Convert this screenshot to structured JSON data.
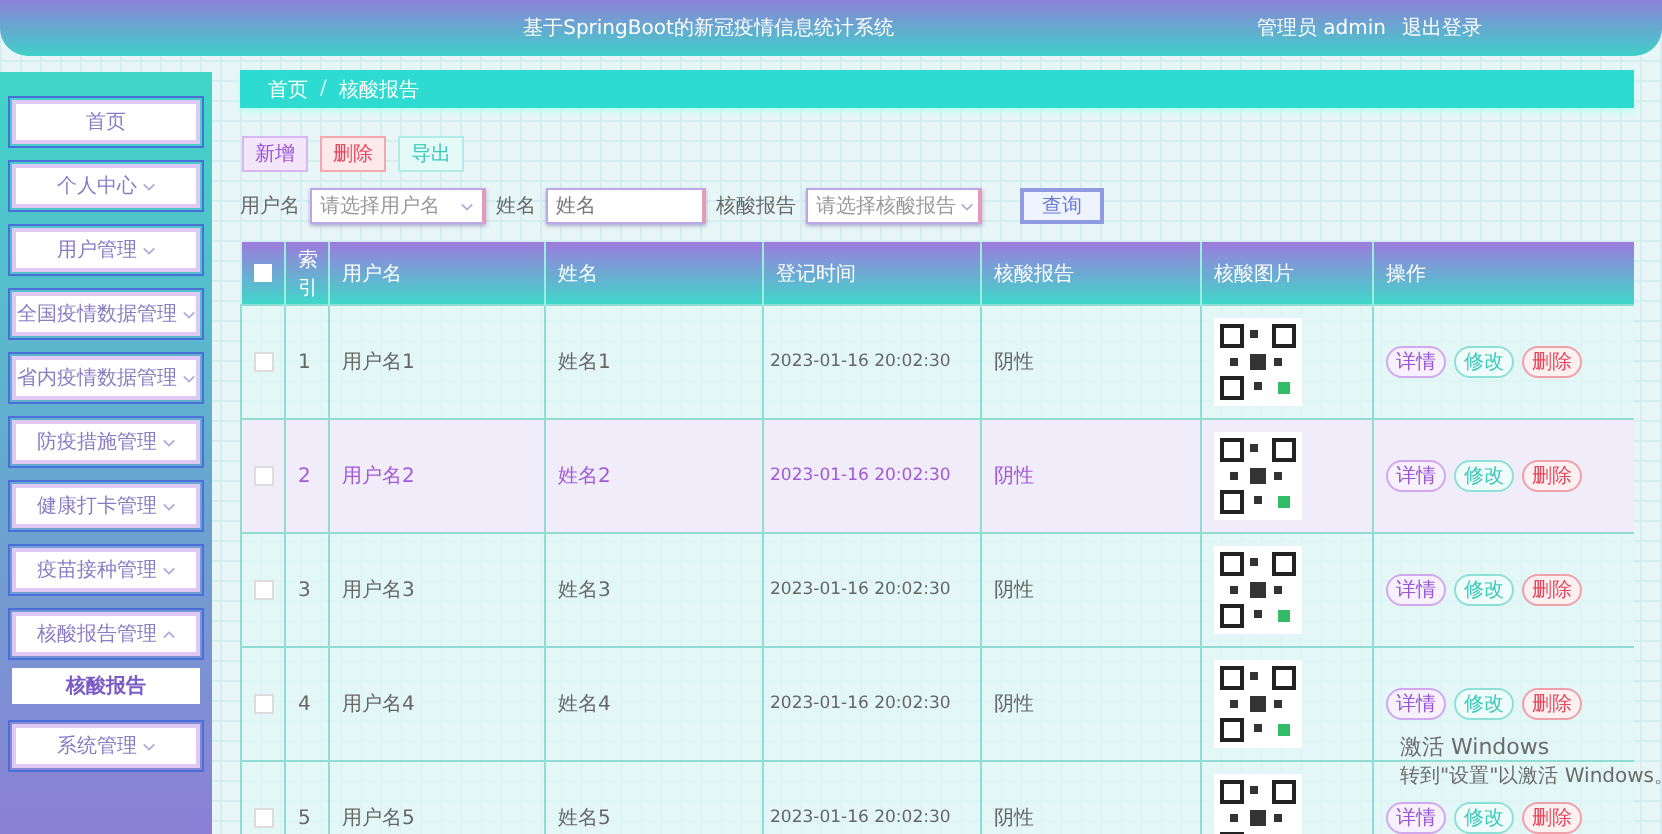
{
  "header": {
    "title": "基于SpringBoot的新冠疫情信息统计系统",
    "user": "管理员 admin",
    "logout": "退出登录"
  },
  "sidebar": {
    "items": [
      {
        "label": "首页",
        "kind": "link",
        "selected": false
      },
      {
        "label": "个人中心",
        "kind": "menu",
        "expanded": false,
        "selected": false
      },
      {
        "label": "用户管理",
        "kind": "menu",
        "expanded": false,
        "selected": false
      },
      {
        "label": "全国疫情数据管理",
        "kind": "menu",
        "expanded": false,
        "selected": false
      },
      {
        "label": "省内疫情数据管理",
        "kind": "menu",
        "expanded": false,
        "selected": false
      },
      {
        "label": "防疫措施管理",
        "kind": "menu",
        "expanded": false,
        "selected": false
      },
      {
        "label": "健康打卡管理",
        "kind": "menu",
        "expanded": false,
        "selected": false
      },
      {
        "label": "疫苗接种管理",
        "kind": "menu",
        "expanded": false,
        "selected": false
      },
      {
        "label": "核酸报告管理",
        "kind": "menu",
        "expanded": true,
        "selected": false,
        "children": [
          {
            "label": "核酸报告",
            "selected": true
          }
        ]
      },
      {
        "label": "系统管理",
        "kind": "menu",
        "expanded": false,
        "selected": false
      }
    ]
  },
  "breadcrumb": {
    "items": [
      "首页",
      "核酸报告"
    ],
    "separator": "/"
  },
  "toolbar": [
    {
      "label": "新增",
      "kind": "add"
    },
    {
      "label": "删除",
      "kind": "delete"
    },
    {
      "label": "导出",
      "kind": "export"
    }
  ],
  "filters": [
    {
      "label": "用户名",
      "kind": "select",
      "placeholder": "请选择用户名"
    },
    {
      "label": "姓名",
      "kind": "text",
      "placeholder": "姓名"
    },
    {
      "label": "核酸报告",
      "kind": "select",
      "placeholder": "请选择核酸报告"
    }
  ],
  "search_button": "查询",
  "table": {
    "select_all": {
      "checked": false
    },
    "columns": [
      "索引",
      "用户名",
      "姓名",
      "登记时间",
      "核酸报告",
      "核酸图片",
      "操作"
    ],
    "rows": [
      {
        "checked": false,
        "highlighted": false,
        "index": "1",
        "username": "用户名1",
        "name": "姓名1",
        "time": "2023-01-16 20:02:30",
        "report": "阴性",
        "actions": [
          "详情",
          "修改",
          "删除"
        ]
      },
      {
        "checked": false,
        "highlighted": true,
        "index": "2",
        "username": "用户名2",
        "name": "姓名2",
        "time": "2023-01-16 20:02:30",
        "report": "阴性",
        "actions": [
          "详情",
          "修改",
          "删除"
        ]
      },
      {
        "checked": false,
        "highlighted": false,
        "index": "3",
        "username": "用户名3",
        "name": "姓名3",
        "time": "2023-01-16 20:02:30",
        "report": "阴性",
        "actions": [
          "详情",
          "修改",
          "删除"
        ]
      },
      {
        "checked": false,
        "highlighted": false,
        "index": "4",
        "username": "用户名4",
        "name": "姓名4",
        "time": "2023-01-16 20:02:30",
        "report": "阴性",
        "actions": [
          "详情",
          "修改",
          "删除"
        ]
      },
      {
        "checked": false,
        "highlighted": false,
        "index": "5",
        "username": "用户名5",
        "name": "姓名5",
        "time": "2023-01-16 20:02:30",
        "report": "阴性",
        "actions": [
          "详情",
          "修改",
          "删除"
        ]
      }
    ]
  },
  "activation_notice": {
    "title": "激活 Windows",
    "text": "转到\"设置\"以激活 Windows。"
  }
}
